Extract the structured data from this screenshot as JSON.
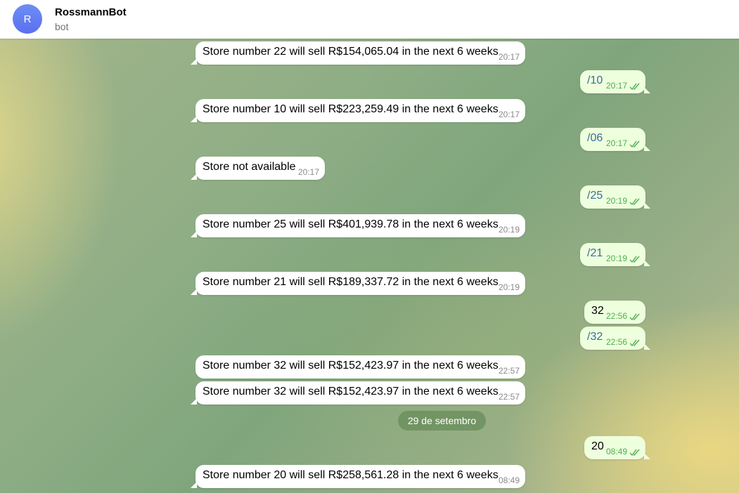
{
  "header": {
    "avatar_letter": "R",
    "title": "RossmannBot",
    "subtitle": "bot"
  },
  "messages": [
    {
      "text": "Store number 22 will sell R$154,065.04 in the next 6 weeks",
      "time": "20:17"
    },
    {
      "text": "/10",
      "time": "20:17"
    },
    {
      "text": "Store number 10 will sell R$223,259.49 in the next 6 weeks",
      "time": "20:17"
    },
    {
      "text": "/06",
      "time": "20:17"
    },
    {
      "text": "Store not available",
      "time": "20:17"
    },
    {
      "text": "/25",
      "time": "20:19"
    },
    {
      "text": "Store number 25 will sell R$401,939.78 in the next 6 weeks",
      "time": "20:19"
    },
    {
      "text": "/21",
      "time": "20:19"
    },
    {
      "text": "Store number 21 will sell R$189,337.72 in the next 6 weeks",
      "time": "20:19"
    },
    {
      "text": "32",
      "time": "22:56"
    },
    {
      "text": "/32",
      "time": "22:56"
    },
    {
      "text": "Store number 32 will sell R$152,423.97 in the next 6 weeks",
      "time": "22:57"
    },
    {
      "text": "Store number 32 will sell R$152,423.97 in the next 6 weeks",
      "time": "22:57"
    },
    {
      "text": "20",
      "time": "08:49"
    },
    {
      "text": "Store number 20 will sell R$258,561.28 in the next 6 weeks",
      "time": "08:49"
    }
  ],
  "date_separator": "29 de setembro",
  "colors": {
    "outgoing_bubble": "#eeffde",
    "incoming_bubble": "#ffffff",
    "command_link": "#3a6d99",
    "read_checks": "#4fae4e"
  }
}
